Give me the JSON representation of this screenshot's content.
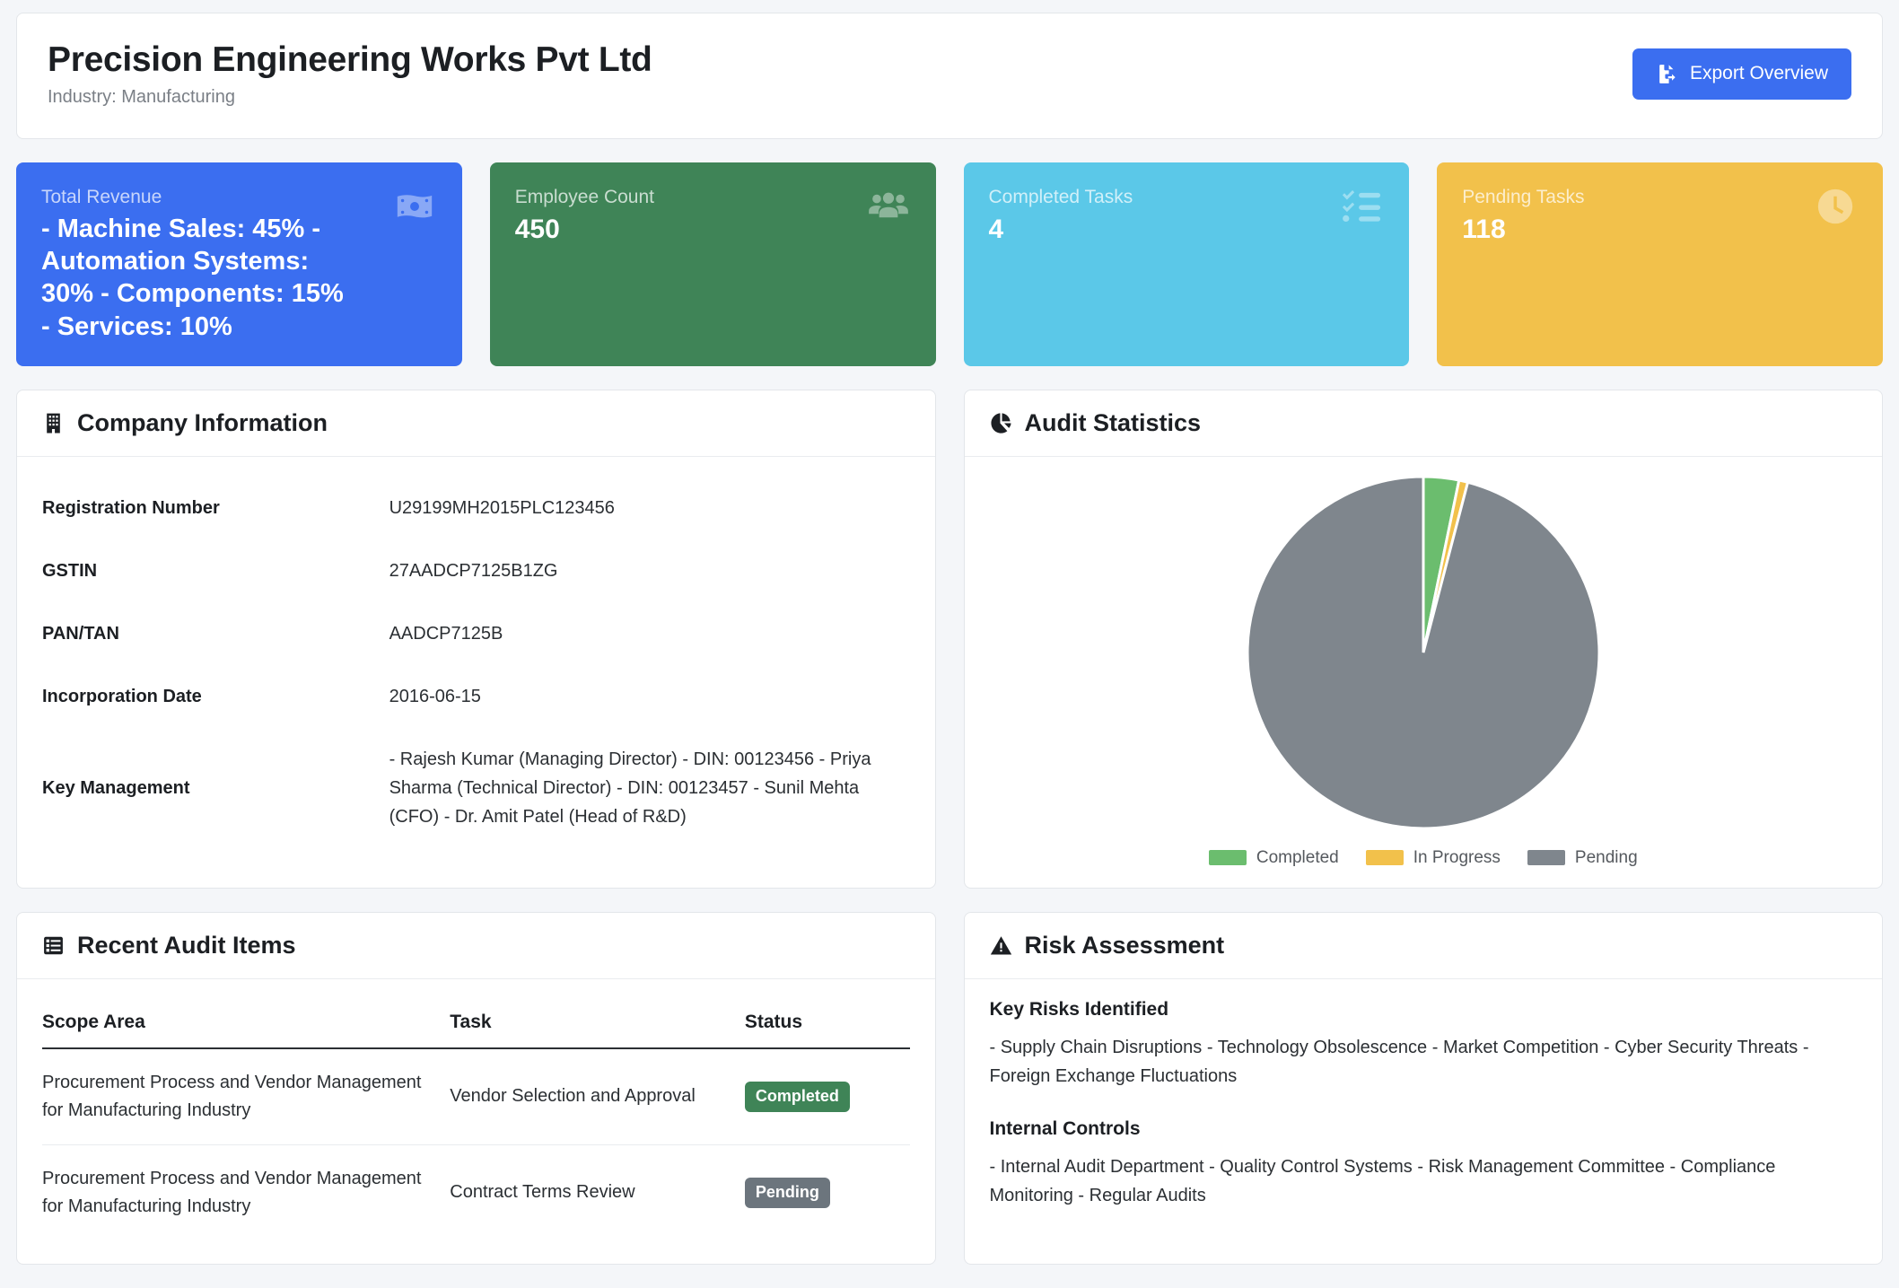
{
  "header": {
    "company_name": "Precision Engineering Works Pvt Ltd",
    "industry_line": "Industry: Manufacturing",
    "export_label": "Export Overview",
    "export_icon": "file-export-icon",
    "accent_color": "#3b6ef0"
  },
  "stats": [
    {
      "label": "Total Revenue",
      "value": "- Machine Sales: 45% - Automation Systems: 30% - Components: 15% - Services: 10%",
      "icon": "money-bill-icon",
      "color": "#3b6ef0"
    },
    {
      "label": "Employee Count",
      "value": "450",
      "icon": "users-group-icon",
      "color": "#3f8457"
    },
    {
      "label": "Completed Tasks",
      "value": "4",
      "icon": "checklist-icon",
      "color": "#5bc8e8"
    },
    {
      "label": "Pending Tasks",
      "value": "118",
      "icon": "clock-icon",
      "color": "#f2c14b"
    }
  ],
  "company_information": {
    "title": "Company Information",
    "icon": "building-icon",
    "rows": [
      {
        "label": "Registration Number",
        "value": "U29199MH2015PLC123456"
      },
      {
        "label": "GSTIN",
        "value": "27AADCP7125B1ZG"
      },
      {
        "label": "PAN/TAN",
        "value": "AADCP7125B"
      },
      {
        "label": "Incorporation Date",
        "value": "2016-06-15"
      },
      {
        "label": "Key Management",
        "value": "- Rajesh Kumar (Managing Director) - DIN: 00123456 - Priya Sharma (Technical Director) - DIN: 00123457 - Sunil Mehta (CFO) - Dr. Amit Patel (Head of R&D)"
      }
    ]
  },
  "audit_statistics": {
    "title": "Audit Statistics",
    "icon": "pie-chart-icon"
  },
  "chart_data": {
    "type": "pie",
    "title": "Audit Statistics",
    "labels": [
      "Completed",
      "In Progress",
      "Pending"
    ],
    "values": [
      4,
      1,
      118
    ],
    "colors": [
      "#6bbd6e",
      "#f2c14b",
      "#7f868d"
    ],
    "legend_position": "bottom",
    "start_angle_deg": 0,
    "slice_angles_deg": [
      11.7,
      2.9,
      345.4
    ]
  },
  "recent_audit_items": {
    "title": "Recent Audit Items",
    "icon": "list-table-icon",
    "columns": [
      "Scope Area",
      "Task",
      "Status"
    ],
    "rows": [
      {
        "scope": "Procurement Process and Vendor Management for Manufacturing Industry",
        "task": "Vendor Selection and Approval",
        "status": "Completed",
        "status_kind": "completed"
      },
      {
        "scope": "Procurement Process and Vendor Management for Manufacturing Industry",
        "task": "Contract Terms Review",
        "status": "Pending",
        "status_kind": "pending"
      }
    ]
  },
  "risk_assessment": {
    "title": "Risk Assessment",
    "icon": "warning-triangle-icon",
    "key_risks_heading": "Key Risks Identified",
    "key_risks_text": "- Supply Chain Disruptions - Technology Obsolescence - Market Competition - Cyber Security Threats - Foreign Exchange Fluctuations",
    "internal_controls_heading": "Internal Controls",
    "internal_controls_text": "- Internal Audit Department - Quality Control Systems - Risk Management Committee - Compliance Monitoring - Regular Audits"
  }
}
